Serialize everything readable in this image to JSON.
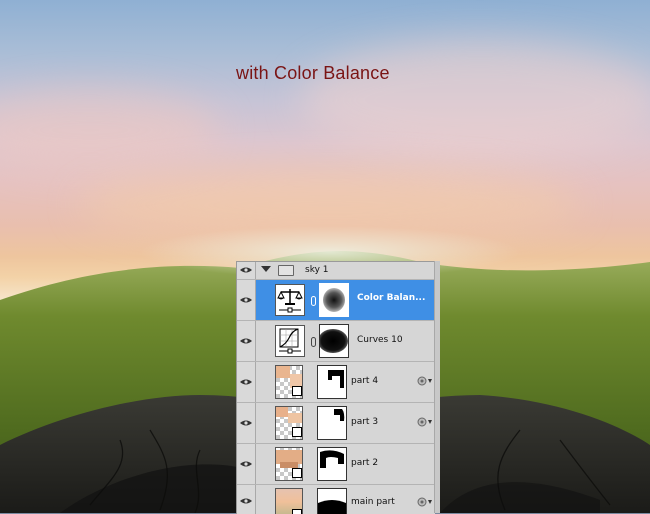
{
  "caption": "with Color Balance",
  "layers_panel": {
    "group": {
      "name": "sky 1",
      "expanded": true,
      "visible": true
    },
    "layers": [
      {
        "name": "Color Balan...",
        "type": "adjustment",
        "adjustment": "color-balance",
        "selected": true,
        "visible": true
      },
      {
        "name": "Curves 10",
        "type": "adjustment",
        "adjustment": "curves",
        "selected": false,
        "visible": true
      },
      {
        "name": "part 4",
        "type": "pixel",
        "selected": false,
        "visible": true,
        "has_effects": true
      },
      {
        "name": "part 3",
        "type": "pixel",
        "selected": false,
        "visible": true,
        "has_effects": true
      },
      {
        "name": "part 2",
        "type": "pixel",
        "selected": false,
        "visible": true,
        "has_effects": false
      },
      {
        "name": "main part",
        "type": "pixel",
        "selected": false,
        "visible": true,
        "has_effects": true
      }
    ]
  },
  "colors": {
    "caption": "#7a1414",
    "selection": "#3f8fe5",
    "panel_bg": "#d6d6d6"
  },
  "icons": {
    "visibility": "eye-icon",
    "color_balance": "scales-icon",
    "curves": "curves-graph-icon",
    "group": "folder-icon",
    "link": "chain-link-icon",
    "effects": "fx-icon"
  }
}
